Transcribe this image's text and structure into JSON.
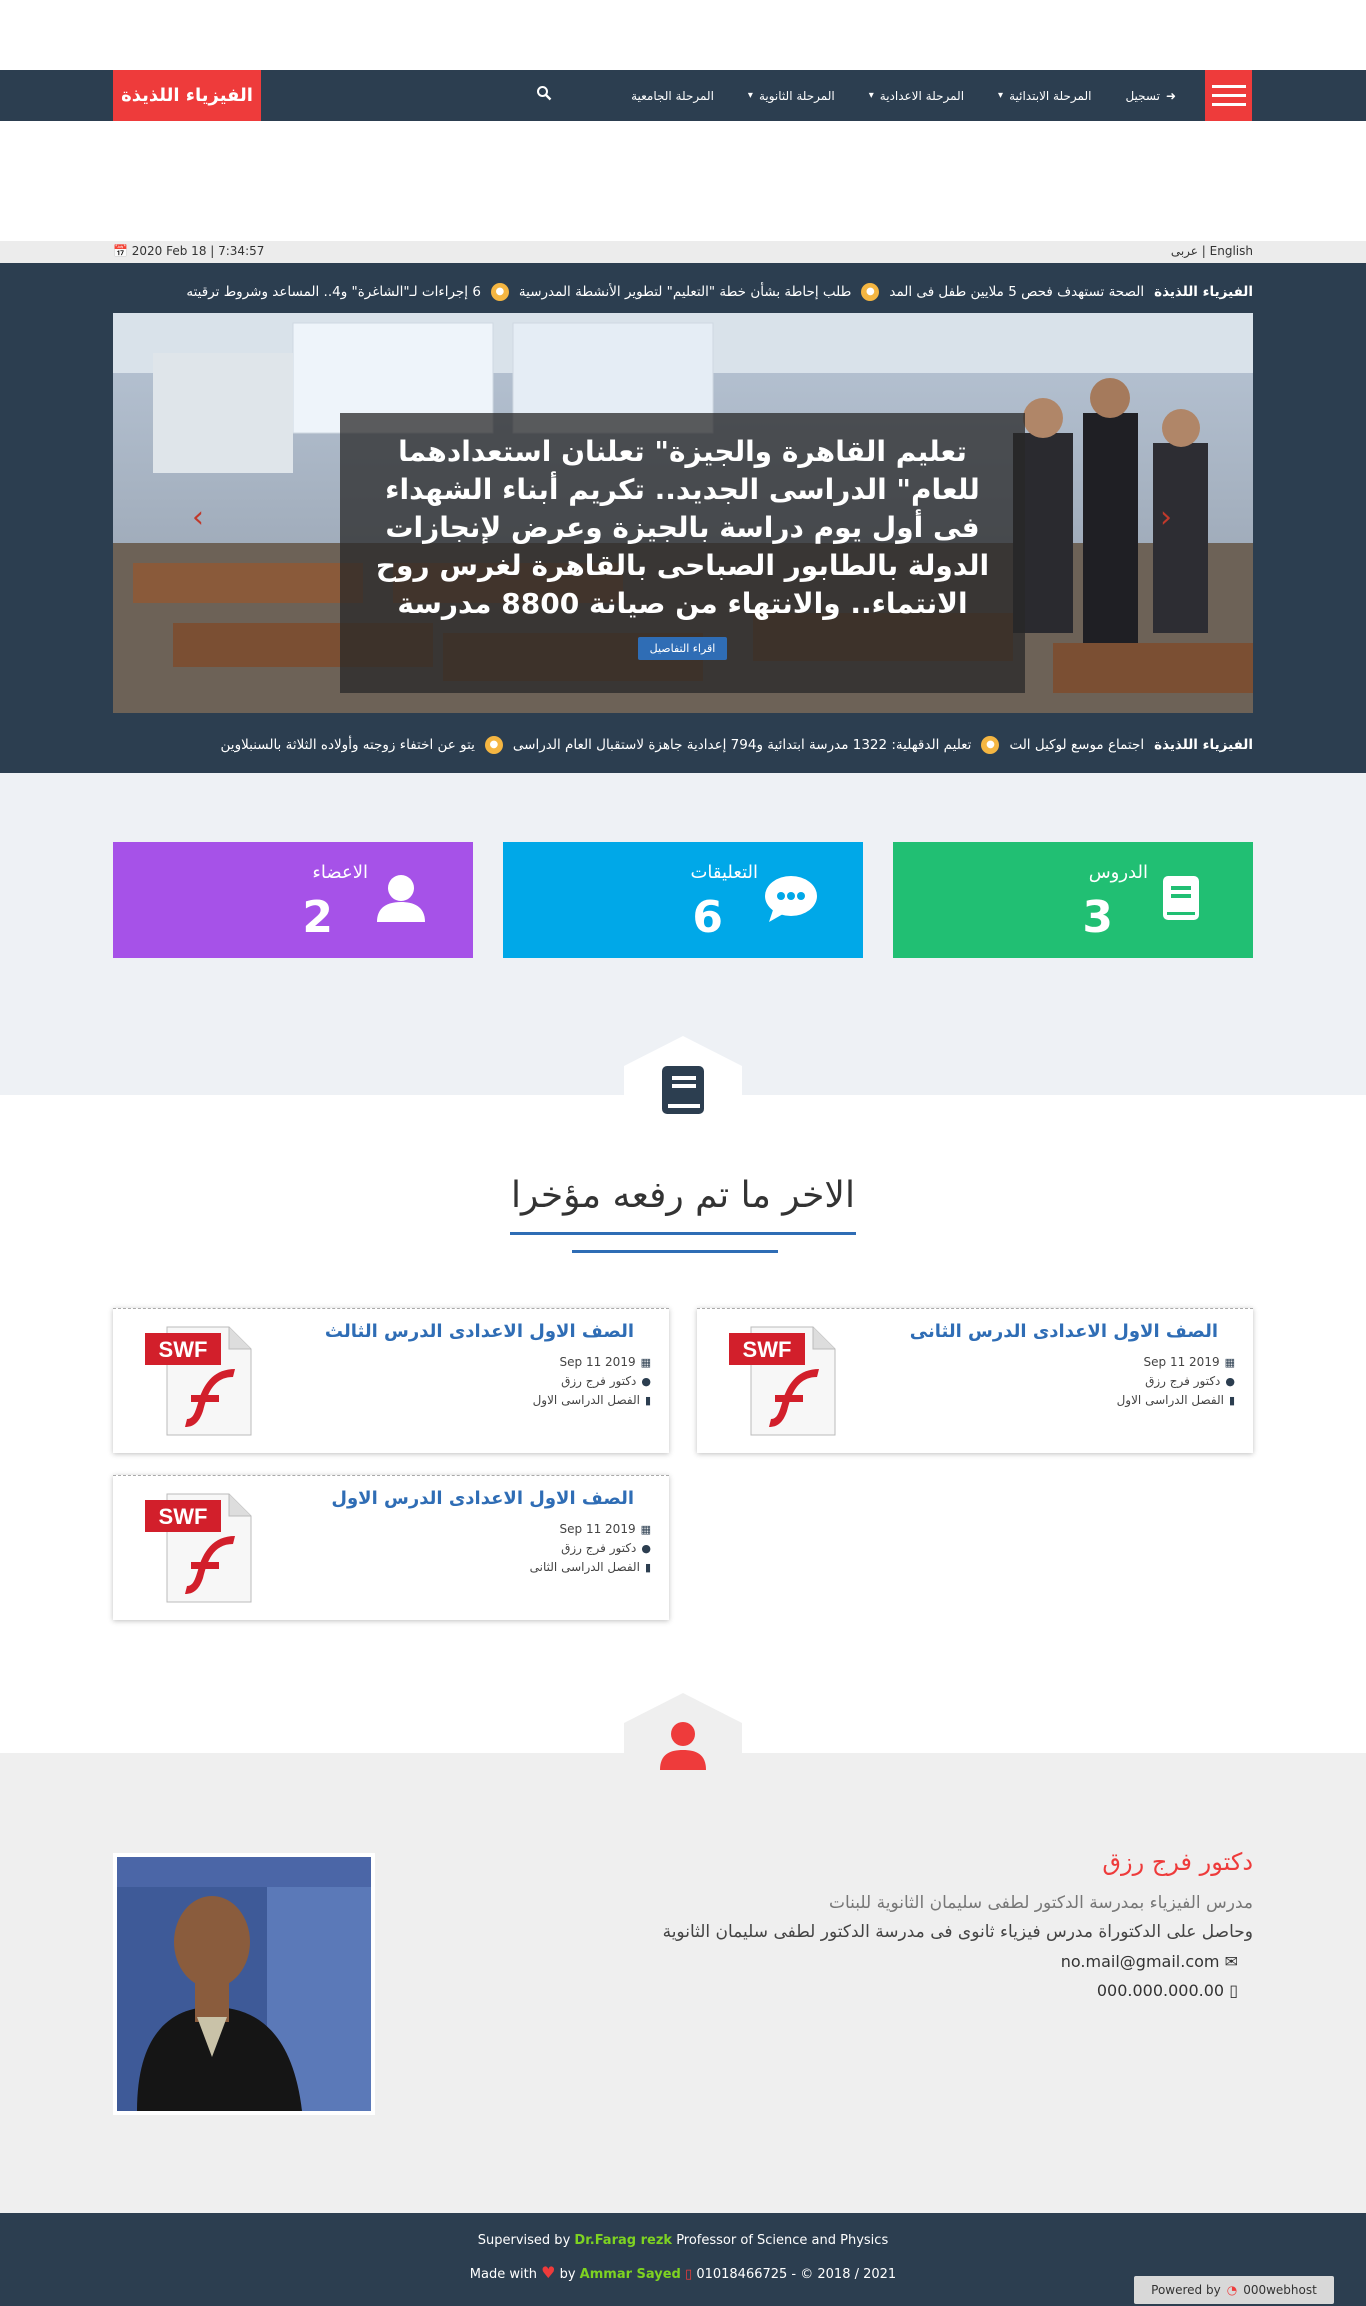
{
  "header": {
    "brand": "الفيزياء اللذيذة",
    "nav": [
      {
        "label": "تسجيل",
        "icon": "sign-in-icon"
      },
      {
        "label": "المرحلة الابتدائية",
        "caret": true
      },
      {
        "label": "المرحلة الاعدادية",
        "caret": true
      },
      {
        "label": "المرحلة الثانوية",
        "caret": true
      },
      {
        "label": "المرحلة الجامعية"
      }
    ],
    "search_icon": "search-icon",
    "menu_icon": "hamburger-icon"
  },
  "topbar": {
    "datetime": "2020 Feb 18 | 7:34:57",
    "lang_en": "English",
    "lang_sep": "|",
    "lang_ar": "عربى"
  },
  "ticker_top": {
    "tag": "الفيزياء اللذيذة",
    "items": [
      "الصحة تستهدف فحص 5 ملايين طفل فى المد",
      "طلب إحاطة بشأن خطة \"التعليم\" لتطوير الأنشطة المدرسية",
      "6 إجراءات لـ\"الشاغرة\" و4.. المساعد وشروط ترقيته"
    ]
  },
  "slider": {
    "caption": "تعليم القاهرة والجيزة\" تعلنان استعدادهما للعام\" الدراسى الجديد.. تكريم أبناء الشهداء فى أول يوم دراسة بالجيزة وعرض لإنجازات الدولة بالطابور الصباحى بالقاهرة لغرس روح الانتماء.. والانتهاء من صيانة 8800 مدرسة",
    "read_more": "اقراء التفاصيل"
  },
  "ticker_bottom": {
    "tag": "الفيزياء اللذيذة",
    "items": [
      "اجتماع موسع لوكيل الت",
      "تعليم الدقهلية: 1322 مدرسة ابتدائية و794 إعدادية جاهزة لاستقبال العام الدراسى",
      "يتو عن اختفاء زوجته وأولاده الثلاثة بالسنبلاوين"
    ]
  },
  "stats": [
    {
      "label": "الدروس",
      "value": "3",
      "color": "#21bf73",
      "icon": "book-icon"
    },
    {
      "label": "التعليقات",
      "value": "6",
      "color": "#00a8e8",
      "icon": "comments-icon"
    },
    {
      "label": "الاعضاء",
      "value": "2",
      "color": "#a652e8",
      "icon": "user-icon"
    }
  ],
  "recent": {
    "title": "الاخر ما تم رفعه مؤخرا",
    "cards": [
      {
        "title": "الصف الاول الاعدادى الدرس الثانى",
        "date": "Sep 11 2019",
        "author": "دكتور فرج رزق",
        "term": "الفصل الدراسى الاول"
      },
      {
        "title": "الصف الاول الاعدادى الدرس الثالث",
        "date": "Sep 11 2019",
        "author": "دكتور فرج رزق",
        "term": "الفصل الدراسى الاول"
      },
      {
        "title": "الصف الاول الاعدادى الدرس الاول",
        "date": "Sep 11 2019",
        "author": "دكتور فرج رزق",
        "term": "الفصل الدراسى الثانى"
      }
    ],
    "swf_label": "SWF"
  },
  "teacher": {
    "name": "دكتور فرج رزق",
    "line1": "مدرس الفيزياء بمدرسة الدكتور لطفى سليمان الثانوية للبنات",
    "line2": "وحاصل على الدكتوراة مدرس فيزياء ثانوى فى مدرسة الدكتور لطفى سليمان الثانوية",
    "email": "no.mail@gmail.com",
    "phone": "000.000.000.00"
  },
  "footer": {
    "supervised_prefix": "Supervised by",
    "supervisor": "Dr.Farag rezk",
    "supervised_suffix": "Professor of Science and Physics",
    "made_with": "Made with",
    "by": "by",
    "developer": "Ammar Sayed",
    "contact": "01018466725 - © 2018 / 2021",
    "powered_by": "Powered by",
    "host": "000webhost"
  }
}
